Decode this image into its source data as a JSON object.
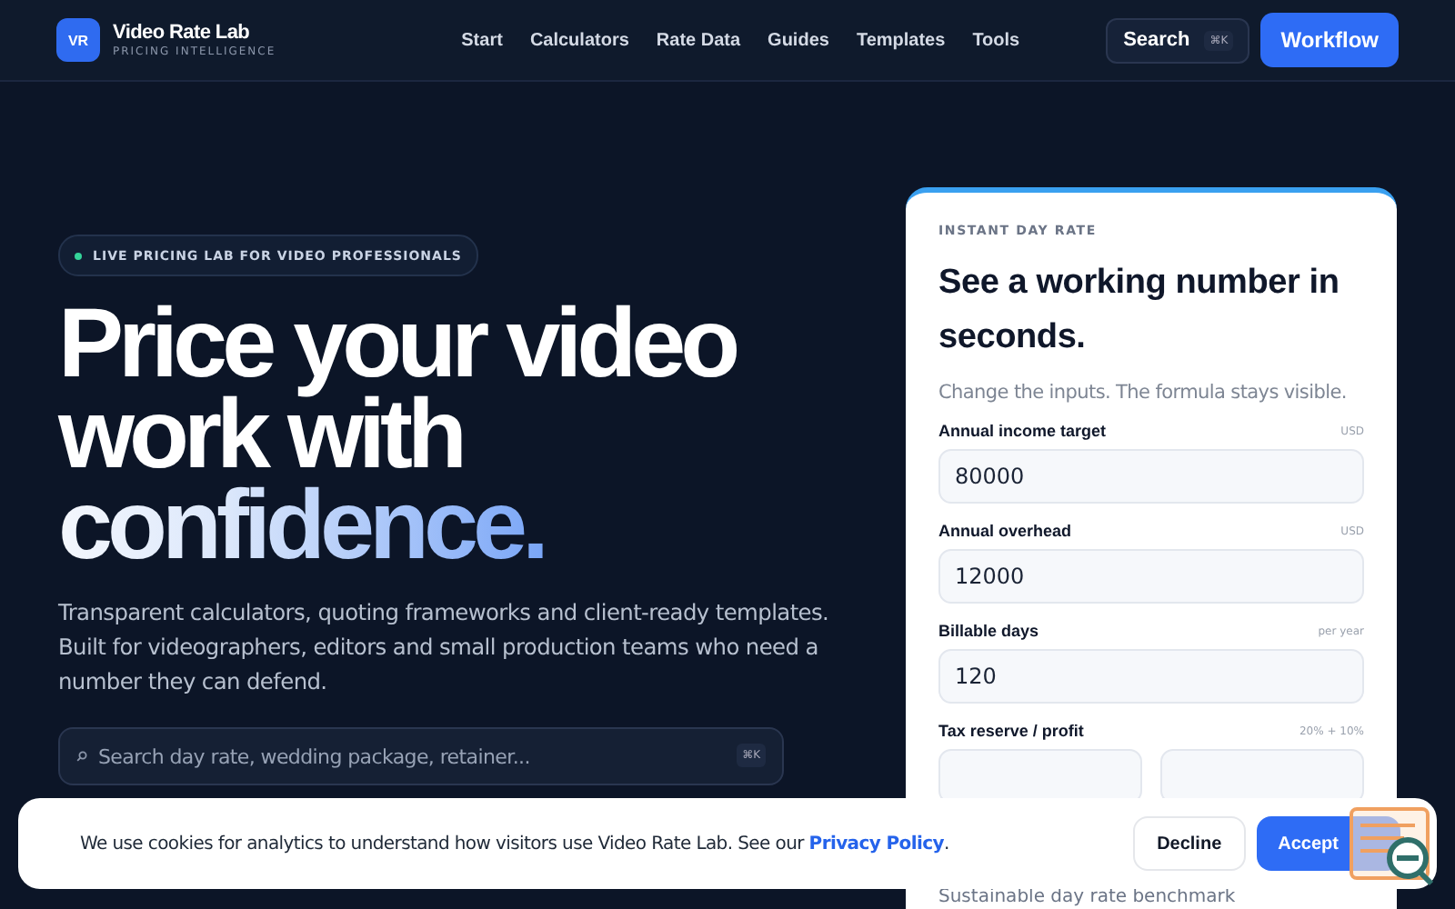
{
  "brand": {
    "initials": "VR",
    "name": "Video Rate Lab",
    "tagline": "PRICING INTELLIGENCE"
  },
  "nav": [
    "Start",
    "Calculators",
    "Rate Data",
    "Guides",
    "Templates",
    "Tools"
  ],
  "search_button": {
    "label": "Search",
    "shortcut": "⌘K"
  },
  "cta": "Workflow",
  "hero": {
    "badge": "LIVE PRICING LAB FOR VIDEO PROFESSIONALS",
    "title": [
      {
        "text": "Price your video",
        "kind": "plain"
      },
      {
        "text": "work with",
        "kind": "plain"
      },
      {
        "text": "confidence.",
        "kind": "gradient"
      }
    ],
    "description": "Transparent calculators, quoting frameworks and client-ready templates. Built for videographers, editors and small production teams who need a number they can defend.",
    "search": {
      "placeholder": "Search day rate, wedding package, retainer...",
      "shortcut": "⌘K"
    }
  },
  "calculator": {
    "eyebrow": "INSTANT DAY RATE",
    "title": "See a working number in seconds.",
    "subtitle": "Change the inputs. The formula stays visible.",
    "fields": [
      {
        "kind": "single",
        "label": "Annual income target",
        "unit": "USD",
        "value": "80000"
      },
      {
        "kind": "single",
        "label": "Annual overhead",
        "unit": "USD",
        "value": "12000"
      },
      {
        "kind": "single",
        "label": "Billable days",
        "unit": "per year",
        "value": "120"
      },
      {
        "kind": "pair",
        "label": "Tax reserve / profit",
        "unit": "20% + 10%"
      }
    ],
    "footer": "Sustainable day rate benchmark"
  },
  "cookie": {
    "text": "We use cookies for analytics to understand how visitors use Video Rate Lab. See our ",
    "link": "Privacy Policy",
    "end": ".",
    "buttons": [
      {
        "label": "Decline",
        "kind": "secondary"
      },
      {
        "label": "Accept",
        "kind": "primary"
      }
    ]
  }
}
